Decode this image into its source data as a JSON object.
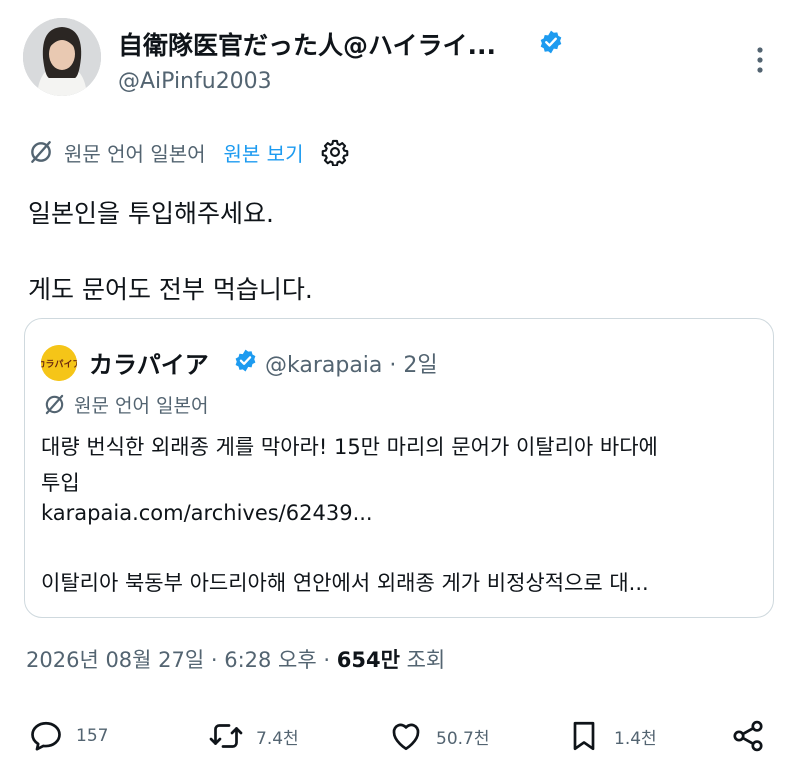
{
  "author": {
    "display_name": "自衛隊医官だった人@ハイライ...",
    "handle": "@AiPinfu2003",
    "verified": true
  },
  "translation": {
    "source_label": "원문 언어 일본어",
    "view_original": "원본 보기"
  },
  "post": {
    "lines": [
      "일본인을 투입해주세요.",
      "게도 문어도 전부 먹습니다."
    ]
  },
  "quoted": {
    "name": "カラパイア",
    "handle_time": "@karapaia · 2일",
    "logo_text": "カラパイア",
    "translation_label": "원문 언어 일본어",
    "lines": [
      "대량 번식한 외래종 게를 막아라! 15만 마리의 문어가 이탈리아 바다에",
      "투입",
      "karapaia.com/archives/62439...",
      "이탈리아 북동부 아드리아해 연안에서 외래종 게가 비정상적으로 대..."
    ]
  },
  "meta": {
    "timestamp": "2026년 08월 27일 · 6:28 오후 · ",
    "views_count": "654만",
    "views_label": " 조회"
  },
  "actions": {
    "replies": "157",
    "reposts": "7.4천",
    "likes": "50.7천",
    "bookmarks": "1.4천"
  },
  "colors": {
    "accent": "#1d9bf0",
    "text": "#0f1419",
    "secondary": "#536471",
    "border": "#cfd9de"
  }
}
